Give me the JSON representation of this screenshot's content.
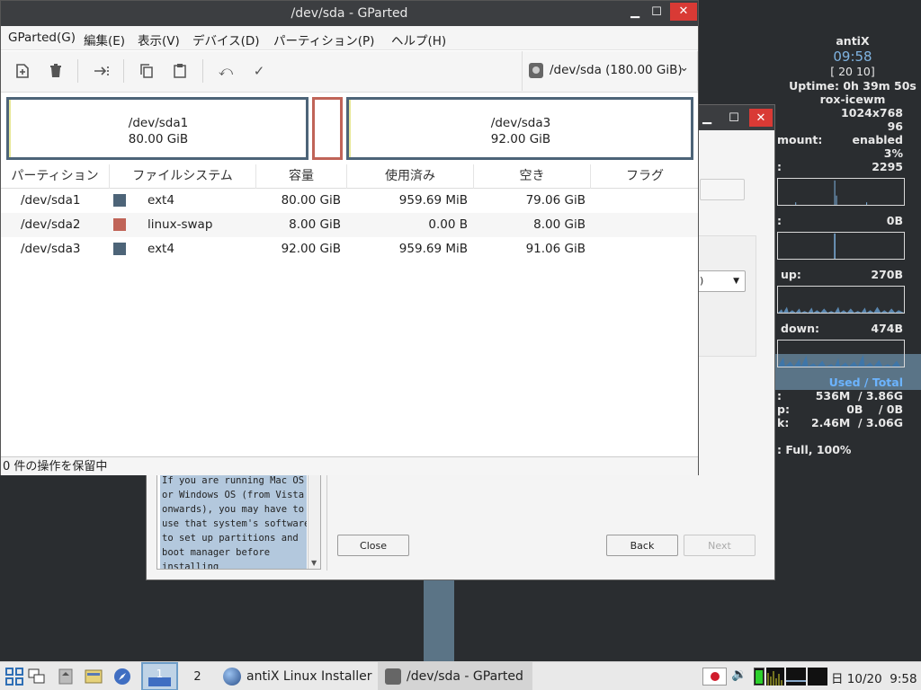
{
  "gparted": {
    "title": "/dev/sda - GParted",
    "menu": [
      "GParted(G)",
      "編集(E)",
      "表示(V)",
      "デバイス(D)",
      "パーティション(P)",
      "ヘルプ(H)"
    ],
    "device": "/dev/sda  (180.00 GiB)",
    "map": [
      {
        "name": "/dev/sda1",
        "size": "80.00 GiB"
      },
      {
        "name": "/dev/sda3",
        "size": "92.00 GiB"
      }
    ],
    "columns": [
      "パーティション",
      "ファイルシステム",
      "容量",
      "使用済み",
      "空き",
      "フラグ"
    ],
    "rows": [
      {
        "partition": "/dev/sda1",
        "fs": "ext4",
        "size": "80.00 GiB",
        "used": "959.69 MiB",
        "free": "79.06 GiB",
        "color": "#4d6478"
      },
      {
        "partition": "/dev/sda2",
        "fs": "linux-swap",
        "size": "8.00 GiB",
        "used": "0.00 B",
        "free": "8.00 GiB",
        "color": "#c06458"
      },
      {
        "partition": "/dev/sda3",
        "fs": "ext4",
        "size": "92.00 GiB",
        "used": "959.69 MiB",
        "free": "91.06 GiB",
        "color": "#4d6478"
      }
    ],
    "status": "0 件の操作を保留中"
  },
  "installer": {
    "help_text": "If you are running Mac OS\nor Windows OS (from Vista\nonwards), you may have to\nuse that system's software\nto set up partitions and\nboot manager before\ninstalling",
    "close_label": "Close",
    "back_label": "Back",
    "next_label": "Next",
    "dropdown_visible": ")"
  },
  "conky": {
    "hostname": "antiX",
    "time": "09:58",
    "date": "[ 20 10]",
    "uptime": "Uptime: 0h 39m 50s",
    "wm": "rox-icewm",
    "resolution": "1024x768",
    "dpi": "96",
    "automount_label": "mount:",
    "automount_value": "enabled",
    "cpu_value": "3%",
    "proc_label": ":",
    "proc_value": "2295",
    "disk_label": ":",
    "disk_value": "0B",
    "up_label": "up:",
    "up_value": "270B",
    "down_label": "down:",
    "down_value": "474B",
    "used_total": "Used / Total",
    "ram_label": ":",
    "ram_value": "536M  / 3.86G",
    "swap_label": "p:",
    "swap_value": "0B    / 0B",
    "disk2_label": "k:",
    "disk2_value": "2.46M  / 3.06G",
    "battery": ": Full, 100%"
  },
  "taskbar": {
    "desktop_1": "1",
    "desktop_2": "2",
    "task_installer": "antiX Linux Installer",
    "task_gparted": "/dev/sda - GParted",
    "clock": "日 10/20  9:58"
  }
}
